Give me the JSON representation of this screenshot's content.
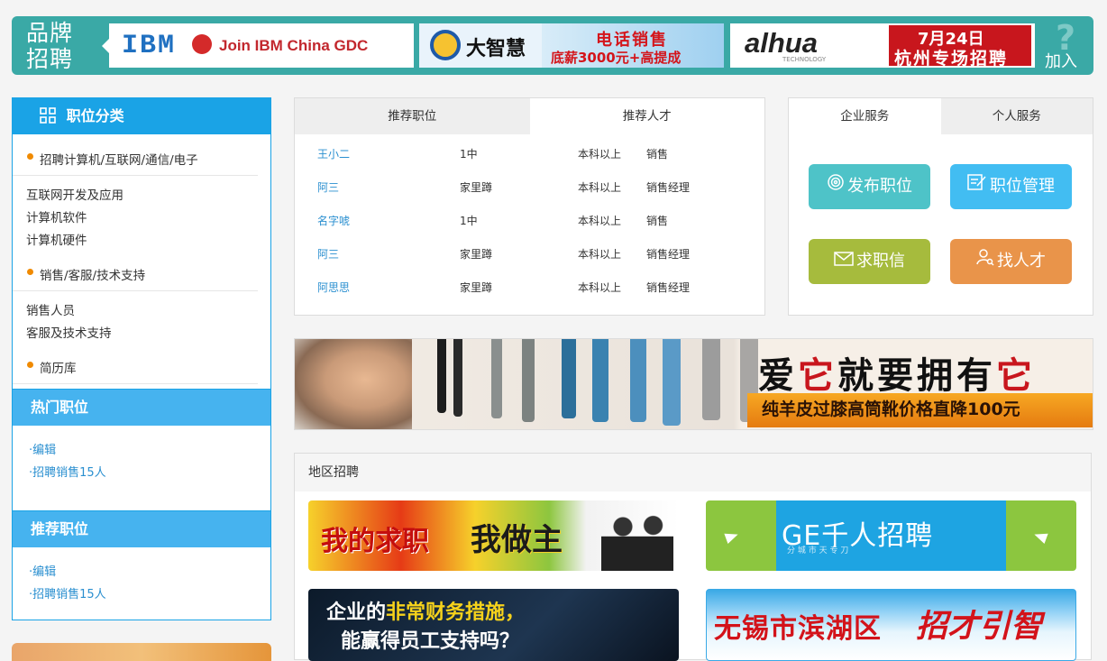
{
  "brand": {
    "title_line1": "品牌",
    "title_line2": "招聘",
    "join": "加入",
    "ad1": {
      "logo": "IBM",
      "text": "Join IBM China GDC"
    },
    "ad2": {
      "logo": "大智慧",
      "line1": "电话销售",
      "line2": "底薪3000元+高提成"
    },
    "ad3": {
      "logo": "alhua",
      "sub": "TECHNOLOGY",
      "line1": "7月24日",
      "line2": "杭州专场招聘"
    }
  },
  "sidebar": {
    "category_title": "职位分类",
    "groups": [
      {
        "title": "招聘计算机/互联网/通信/电子",
        "items": [
          "互联网开发及应用",
          "计算机软件",
          "计算机硬件"
        ]
      },
      {
        "title": "销售/客服/技术支持",
        "items": [
          "销售人员",
          "客服及技术支持"
        ]
      },
      {
        "title": "简历库",
        "items": []
      }
    ],
    "hot_title": "热门职位",
    "hot_items": [
      "·编辑",
      "·招聘销售15人"
    ],
    "rec_title": "推荐职位",
    "rec_items": [
      "·编辑",
      "·招聘销售15人"
    ]
  },
  "recommend": {
    "tabs": [
      "推荐职位",
      "推荐人才"
    ],
    "rows": [
      {
        "name": "王小二",
        "place": "1中",
        "edu": "本科以上",
        "job": "销售"
      },
      {
        "name": "阿三",
        "place": "家里蹲",
        "edu": "本科以上",
        "job": "销售经理"
      },
      {
        "name": "名字唬",
        "place": "1中",
        "edu": "本科以上",
        "job": "销售"
      },
      {
        "name": "阿三",
        "place": "家里蹲",
        "edu": "本科以上",
        "job": "销售经理"
      },
      {
        "name": "阿思思",
        "place": "家里蹲",
        "edu": "本科以上",
        "job": "销售经理"
      }
    ]
  },
  "services": {
    "tabs": [
      "企业服务",
      "个人服务"
    ],
    "buttons": [
      {
        "label": "发布职位",
        "color": "#4ec3c8"
      },
      {
        "label": "职位管理",
        "color": "#42bdf2"
      },
      {
        "label": "求职信",
        "color": "#a6bb3d"
      },
      {
        "label": "找人才",
        "color": "#e9944a"
      }
    ]
  },
  "boots_banner": {
    "headline_a": "爱",
    "headline_b": "它",
    "headline_c": "就要拥有",
    "headline_d": "它",
    "sub": "纯羊皮过膝高筒靴价格直降100元"
  },
  "region": {
    "title": "地区招聘",
    "ads": [
      {
        "a": "我的求职",
        "b": "我做主"
      },
      {
        "a": "GE千人招聘",
        "b": "分 城 市    天 专 刀"
      },
      {
        "a": "企业的",
        "b": "非常财务措施，",
        "c": "能赢得员工支持吗？"
      },
      {
        "a": "无锡市滨湖区",
        "b": "招才引智"
      }
    ]
  },
  "colors": {
    "teal": "#3aa9a6",
    "blue": "#1aa3e6",
    "orange": "#f08a00"
  }
}
